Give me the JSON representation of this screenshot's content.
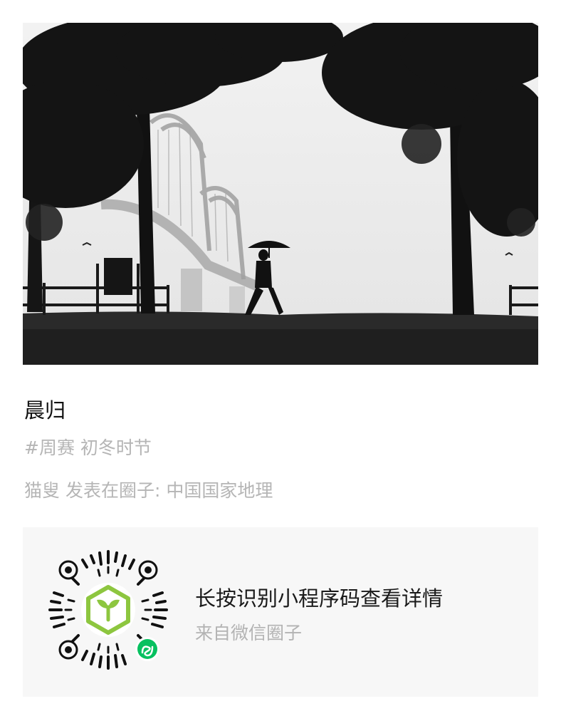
{
  "post": {
    "title": "晨归",
    "tags": "#周赛 初冬时节",
    "author_line": "猫叟 发表在圈子: 中国国家地理"
  },
  "mini_program_card": {
    "title": "长按识别小程序码查看详情",
    "subtitle": "来自微信圈子"
  },
  "icons": {
    "qr_code": "mini-program-qr-code",
    "qr_center_logo": "circle-sprout-logo",
    "badge": "mini-program-link-badge"
  },
  "colors": {
    "logo_green": "#8dc63f",
    "badge_green": "#07c160",
    "muted_text": "#b5b5b5",
    "card_bg": "#f7f7f7"
  }
}
